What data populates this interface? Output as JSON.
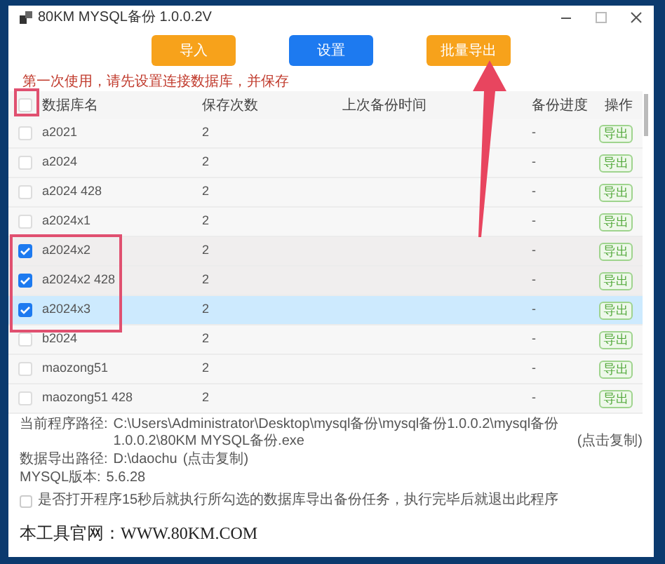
{
  "window": {
    "title": "80KM MYSQL备份 1.0.0.2V"
  },
  "toolbar": [
    {
      "label": "导入",
      "kind": "warning"
    },
    {
      "label": "设置",
      "kind": "primary"
    },
    {
      "label": "批量导出",
      "kind": "warning"
    }
  ],
  "notice": "第一次使用，请先设置连接数据库，并保存",
  "table": {
    "header_checked": false,
    "columns": [
      "数据库名",
      "保存次数",
      "上次备份时间",
      "备份进度",
      "操作"
    ],
    "rows": [
      {
        "name": "a2021",
        "count": "2",
        "progress": "-",
        "action": "导出",
        "checked": false,
        "selected": false
      },
      {
        "name": "a2024",
        "count": "2",
        "progress": "-",
        "action": "导出",
        "checked": false,
        "selected": false
      },
      {
        "name": "a2024 428",
        "count": "2",
        "progress": "-",
        "action": "导出",
        "checked": false,
        "selected": false
      },
      {
        "name": "a2024x1",
        "count": "2",
        "progress": "-",
        "action": "导出",
        "checked": false,
        "selected": false
      },
      {
        "name": "a2024x2",
        "count": "2",
        "progress": "-",
        "action": "导出",
        "checked": true,
        "selected": false
      },
      {
        "name": "a2024x2 428",
        "count": "2",
        "progress": "-",
        "action": "导出",
        "checked": true,
        "selected": false
      },
      {
        "name": "a2024x3",
        "count": "2",
        "progress": "-",
        "action": "导出",
        "checked": true,
        "selected": true
      },
      {
        "name": "b2024",
        "count": "2",
        "progress": "-",
        "action": "导出",
        "checked": false,
        "selected": false
      },
      {
        "name": "maozong51",
        "count": "2",
        "progress": "-",
        "action": "导出",
        "checked": false,
        "selected": false
      },
      {
        "name": "maozong51 428",
        "count": "2",
        "progress": "-",
        "action": "导出",
        "checked": false,
        "selected": false
      }
    ]
  },
  "info": [
    {
      "label": "当前程序路径:",
      "value": "C:\\Users\\Administrator\\Desktop\\mysql备份\\mysql备份1.0.0.2\\mysql备份 1.0.0.2\\80KM MYSQL备份.exe",
      "link": "(点击复制)"
    },
    {
      "label": "数据导出路径:",
      "value": "D:\\daochu",
      "link": "(点击复制)"
    },
    {
      "label": "MYSQL版本:",
      "value": "5.6.28"
    }
  ],
  "auto_option": {
    "label": "是否打开程序15秒后就执行所勾选的数据库导出备份任务，执行完毕后就退出此程序",
    "checked": false
  },
  "site": "本工具官网：WWW.80KM.COM"
}
